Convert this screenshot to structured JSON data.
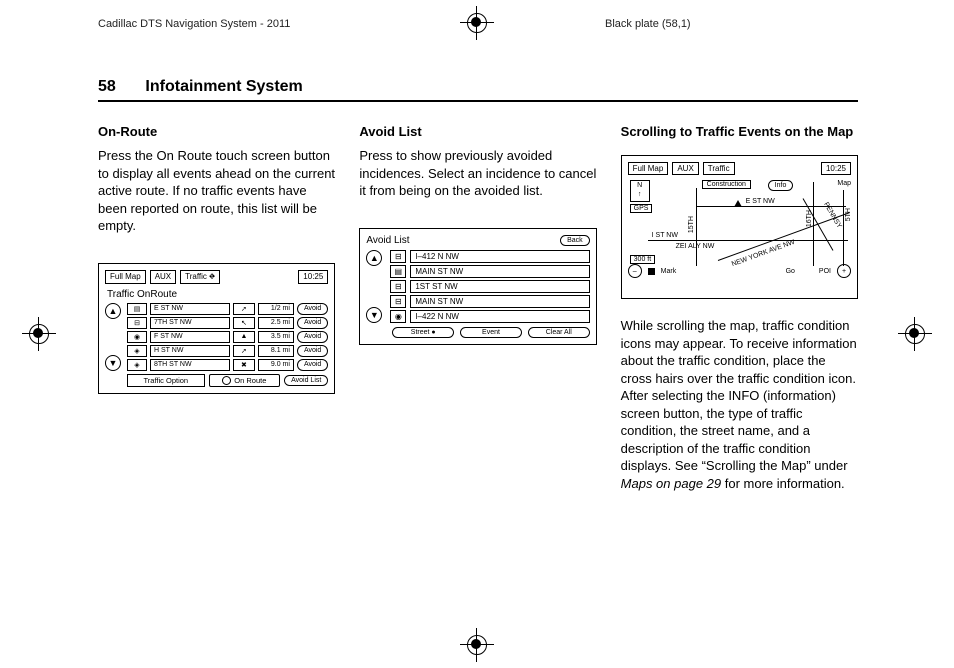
{
  "header": {
    "left": "Cadillac DTS Navigation System - 2011",
    "right": "Black plate (58,1)"
  },
  "page": {
    "number": "58",
    "chapter": "Infotainment System"
  },
  "col1": {
    "heading": "On-Route",
    "para": "Press the On Route touch screen button to display all events ahead on the current active route. If no traffic events have been reported on route, this list will be empty.",
    "fig": {
      "tabs": {
        "fullmap": "Full Map",
        "aux": "AUX",
        "traffic": "Traffic",
        "time": "10:25"
      },
      "title": "Traffic OnRoute",
      "rows": [
        {
          "name": "E ST NW",
          "dist": "1/2 mi",
          "avoid": "Avoid"
        },
        {
          "name": "7TH ST NW",
          "dist": "2.5 mi",
          "avoid": "Avoid"
        },
        {
          "name": "F ST NW",
          "dist": "3.5 mi",
          "avoid": "Avoid"
        },
        {
          "name": "H ST NW",
          "dist": "8.1 mi",
          "avoid": "Avoid"
        },
        {
          "name": "8TH ST NW",
          "dist": "9.0 mi",
          "avoid": "Avoid"
        }
      ],
      "footer": {
        "option": "Traffic Option",
        "onroute": "On Route",
        "avoidlist": "Avoid List"
      }
    }
  },
  "col2": {
    "heading": "Avoid List",
    "para": "Press to show previously avoided incidences. Select an incidence to cancel it from being on the avoided list.",
    "fig": {
      "title": "Avoid List",
      "back": "Back",
      "rows": [
        {
          "name": "I–412 N NW"
        },
        {
          "name": "MAIN ST NW"
        },
        {
          "name": "1ST ST NW"
        },
        {
          "name": "MAIN ST NW"
        },
        {
          "name": "I–422 N NW"
        }
      ],
      "footer": {
        "street": "Street",
        "event": "Event",
        "clear": "Clear All"
      }
    }
  },
  "col3": {
    "heading": "Scrolling to Traffic Events on the Map",
    "fig": {
      "tabs": {
        "fullmap": "Full Map",
        "aux": "AUX",
        "traffic": "Traffic",
        "time": "10:25"
      },
      "compass_n": "N",
      "gps": "GPS",
      "construction": "Construction",
      "info": "Info",
      "map": "Map",
      "scale": "300 ft",
      "roads": {
        "st15": "15TH",
        "st16": "16TH",
        "st5": "5TH",
        "est": "E ST NW",
        "ist": "I ST NW",
        "zei": "ZEI ALY NW",
        "penn": "PENNSY",
        "nyave": "NEW YORK AVE NW"
      },
      "bottom": {
        "mark": "Mark",
        "go": "Go",
        "poi": "POI"
      }
    },
    "para1": "While scrolling the map, traffic condition icons may appear. To receive information about the traffic condition, place the cross hairs over the traffic condition icon. After selecting the INFO (information) screen button, the type of traffic condition, the street name, and a description of the traffic condition displays. See “Scrolling the Map” under ",
    "para_link": "Maps on page 29",
    "para2": " for more information."
  }
}
